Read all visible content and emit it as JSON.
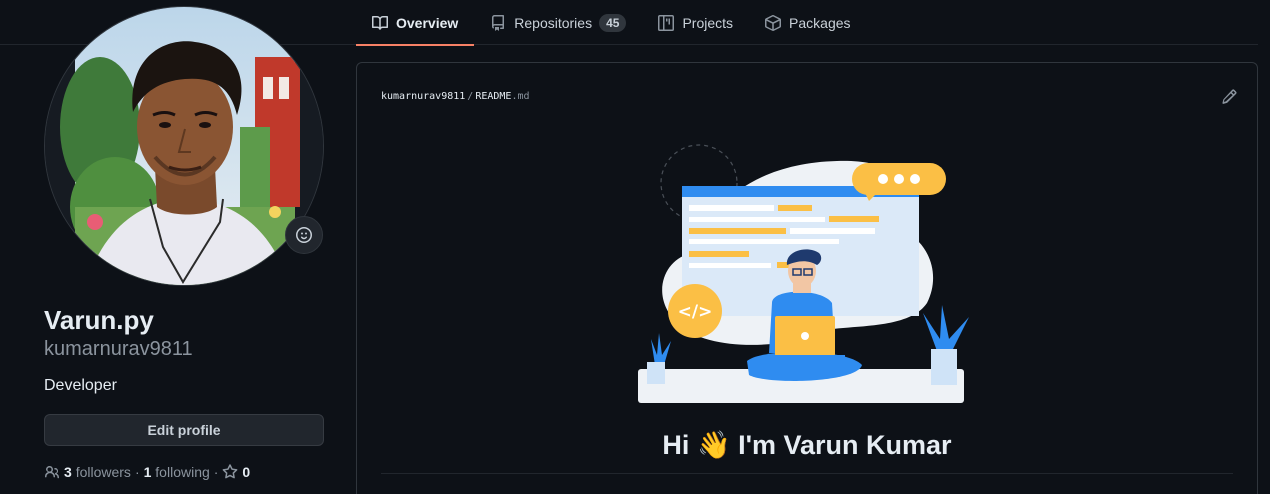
{
  "nav": {
    "tabs": [
      {
        "label": "Overview",
        "icon": "book-icon",
        "active": true
      },
      {
        "label": "Repositories",
        "icon": "repo-icon",
        "count": "45"
      },
      {
        "label": "Projects",
        "icon": "table-icon"
      },
      {
        "label": "Packages",
        "icon": "package-icon"
      }
    ]
  },
  "profile": {
    "display_name": "Varun.py",
    "username": "kumarnurav9811",
    "bio": "Developer",
    "edit_label": "Edit profile",
    "followers_count": "3",
    "followers_label": "followers",
    "following_count": "1",
    "following_label": "following",
    "stars_count": "0"
  },
  "readme": {
    "owner": "kumarnurav9811",
    "separator": "/",
    "file_base": "README",
    "file_ext": ".md",
    "greeting_before": "Hi",
    "greeting_emoji": "👋",
    "greeting_after": "I'm Varun Kumar"
  },
  "colors": {
    "background": "#0d1117",
    "accent_tab": "#f78166",
    "illustration_blue": "#2f8cf0",
    "illustration_orange": "#fbbf45"
  }
}
